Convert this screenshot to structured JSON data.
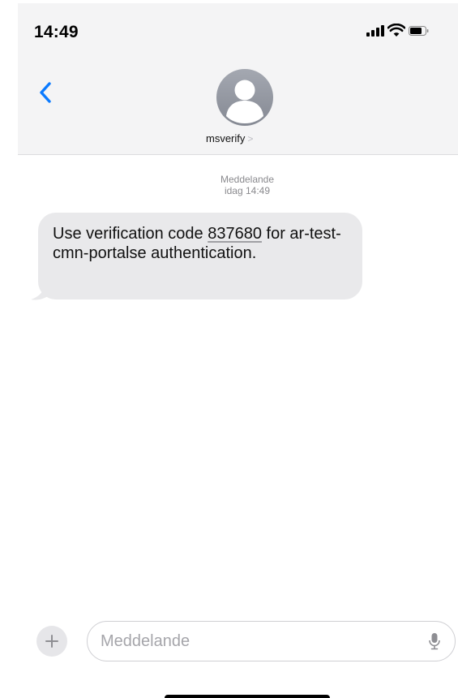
{
  "status_bar": {
    "time": "14:49",
    "signal_icon": "cellular-signal-icon",
    "wifi_icon": "wifi-icon",
    "battery_icon": "battery-icon"
  },
  "nav": {
    "back_icon": "chevron-left-icon",
    "contact_name": "msverify",
    "contact_chevron": ">",
    "avatar_icon": "person-avatar-icon"
  },
  "conversation": {
    "service_label": "Meddelande",
    "timestamp": "idag 14:49",
    "messages": [
      {
        "direction": "incoming",
        "text_before": "Use verification code ",
        "code": "837680",
        "text_after": " for ar-test-cmn-portalse authentication."
      }
    ]
  },
  "compose": {
    "plus_icon": "plus-icon",
    "placeholder": "Meddelande",
    "value": "",
    "mic_icon": "microphone-icon"
  },
  "colors": {
    "accent": "#0a7aff",
    "bubble_incoming": "#e9e9eb",
    "header_background": "#f4f4f5",
    "secondary_text": "#8a8a8e"
  }
}
